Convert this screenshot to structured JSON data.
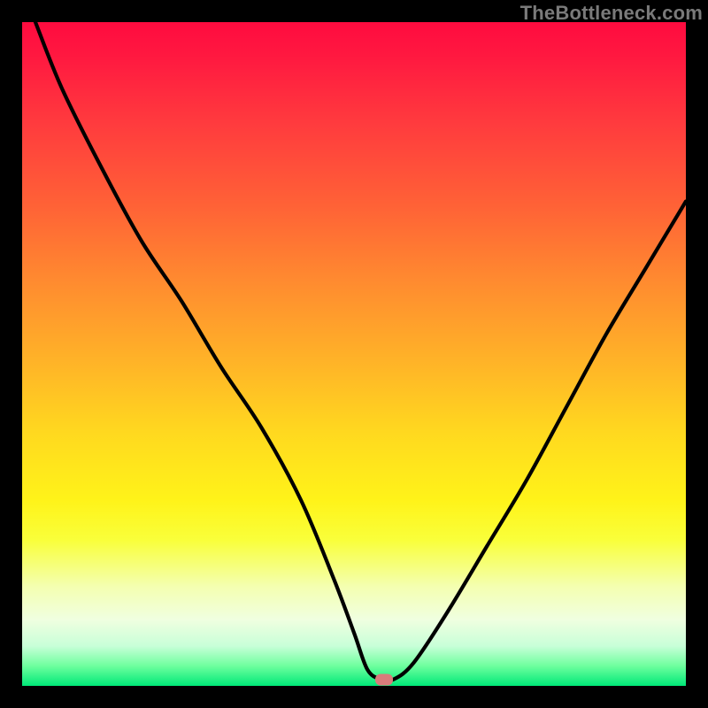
{
  "watermark": "TheBottleneck.com",
  "chart_data": {
    "type": "line",
    "title": "",
    "xlabel": "",
    "ylabel": "",
    "xlim": [
      0,
      100
    ],
    "ylim": [
      0,
      100
    ],
    "series": [
      {
        "name": "bottleneck-curve",
        "x_percent_of_width": [
          2,
          6,
          12,
          18,
          24,
          30,
          36,
          42,
          47,
          50,
          52,
          54,
          56,
          59,
          64,
          70,
          76,
          82,
          88,
          94,
          100
        ],
        "y_percent_from_top": [
          0,
          10,
          22,
          33,
          42,
          52,
          61,
          72,
          84,
          92,
          97.5,
          99,
          99,
          96.5,
          89,
          79,
          69,
          58,
          47,
          37,
          27
        ]
      }
    ],
    "marker": {
      "x_percent": 54.5,
      "y_percent_from_top": 99
    },
    "gradient_stops": [
      {
        "pos": 0,
        "color": "#ff0b3f"
      },
      {
        "pos": 15,
        "color": "#ff3a3e"
      },
      {
        "pos": 40,
        "color": "#ff8e2f"
      },
      {
        "pos": 62,
        "color": "#ffd91f"
      },
      {
        "pos": 78,
        "color": "#f9ff3a"
      },
      {
        "pos": 94,
        "color": "#c8ffd8"
      },
      {
        "pos": 100,
        "color": "#00e878"
      }
    ]
  }
}
